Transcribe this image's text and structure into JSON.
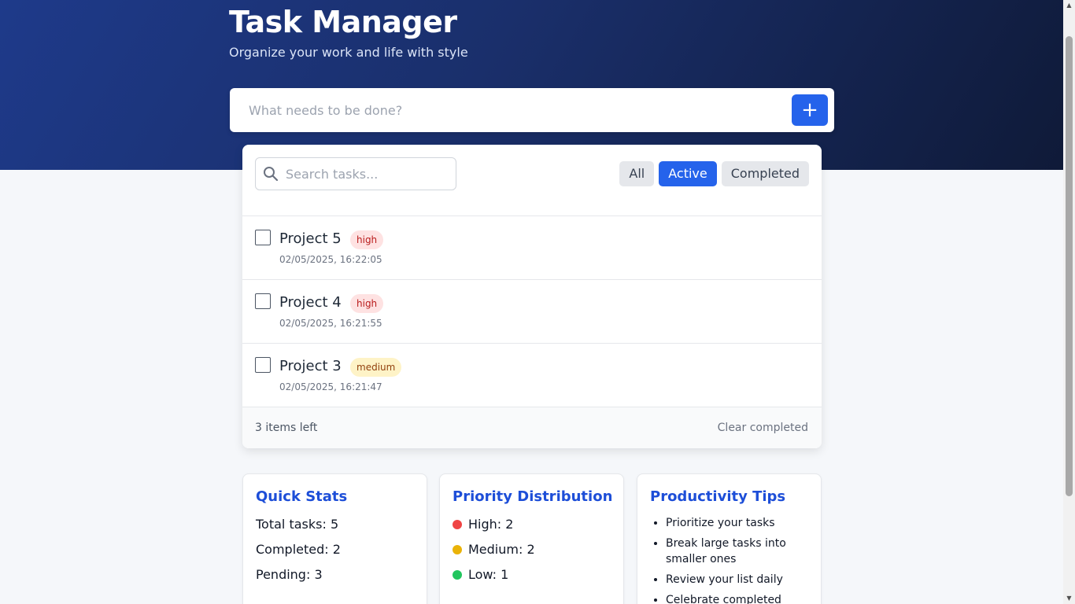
{
  "header": {
    "title": "Task Manager",
    "subtitle": "Organize your work and life with style"
  },
  "add_task": {
    "placeholder": "What needs to be done?",
    "button_label": "+"
  },
  "search": {
    "placeholder": "Search tasks..."
  },
  "filters": [
    {
      "label": "All",
      "active": false
    },
    {
      "label": "Active",
      "active": true
    },
    {
      "label": "Completed",
      "active": false
    }
  ],
  "tasks": [
    {
      "title": "Project 5",
      "priority": "high",
      "date": "02/05/2025, 16:22:05"
    },
    {
      "title": "Project 4",
      "priority": "high",
      "date": "02/05/2025, 16:21:55"
    },
    {
      "title": "Project 3",
      "priority": "medium",
      "date": "02/05/2025, 16:21:47"
    }
  ],
  "footer": {
    "items_left": "3 items left",
    "clear_completed": "Clear completed"
  },
  "quick_stats": {
    "title": "Quick Stats",
    "total": "Total tasks: 5",
    "completed": "Completed: 2",
    "pending": "Pending: 3"
  },
  "priority_distribution": {
    "title": "Priority Distribution",
    "high": "High: 2",
    "medium": "Medium: 2",
    "low": "Low: 1",
    "colors": {
      "high": "#ef4444",
      "medium": "#eab308",
      "low": "#22c55e"
    }
  },
  "productivity_tips": {
    "title": "Productivity Tips",
    "tips": [
      "Prioritize your tasks",
      "Break large tasks into smaller ones",
      "Review your list daily",
      "Celebrate completed"
    ]
  },
  "colors": {
    "accent": "#2563eb",
    "header_gradient_start": "#1e3a8a",
    "header_gradient_end": "#0f1a38"
  }
}
